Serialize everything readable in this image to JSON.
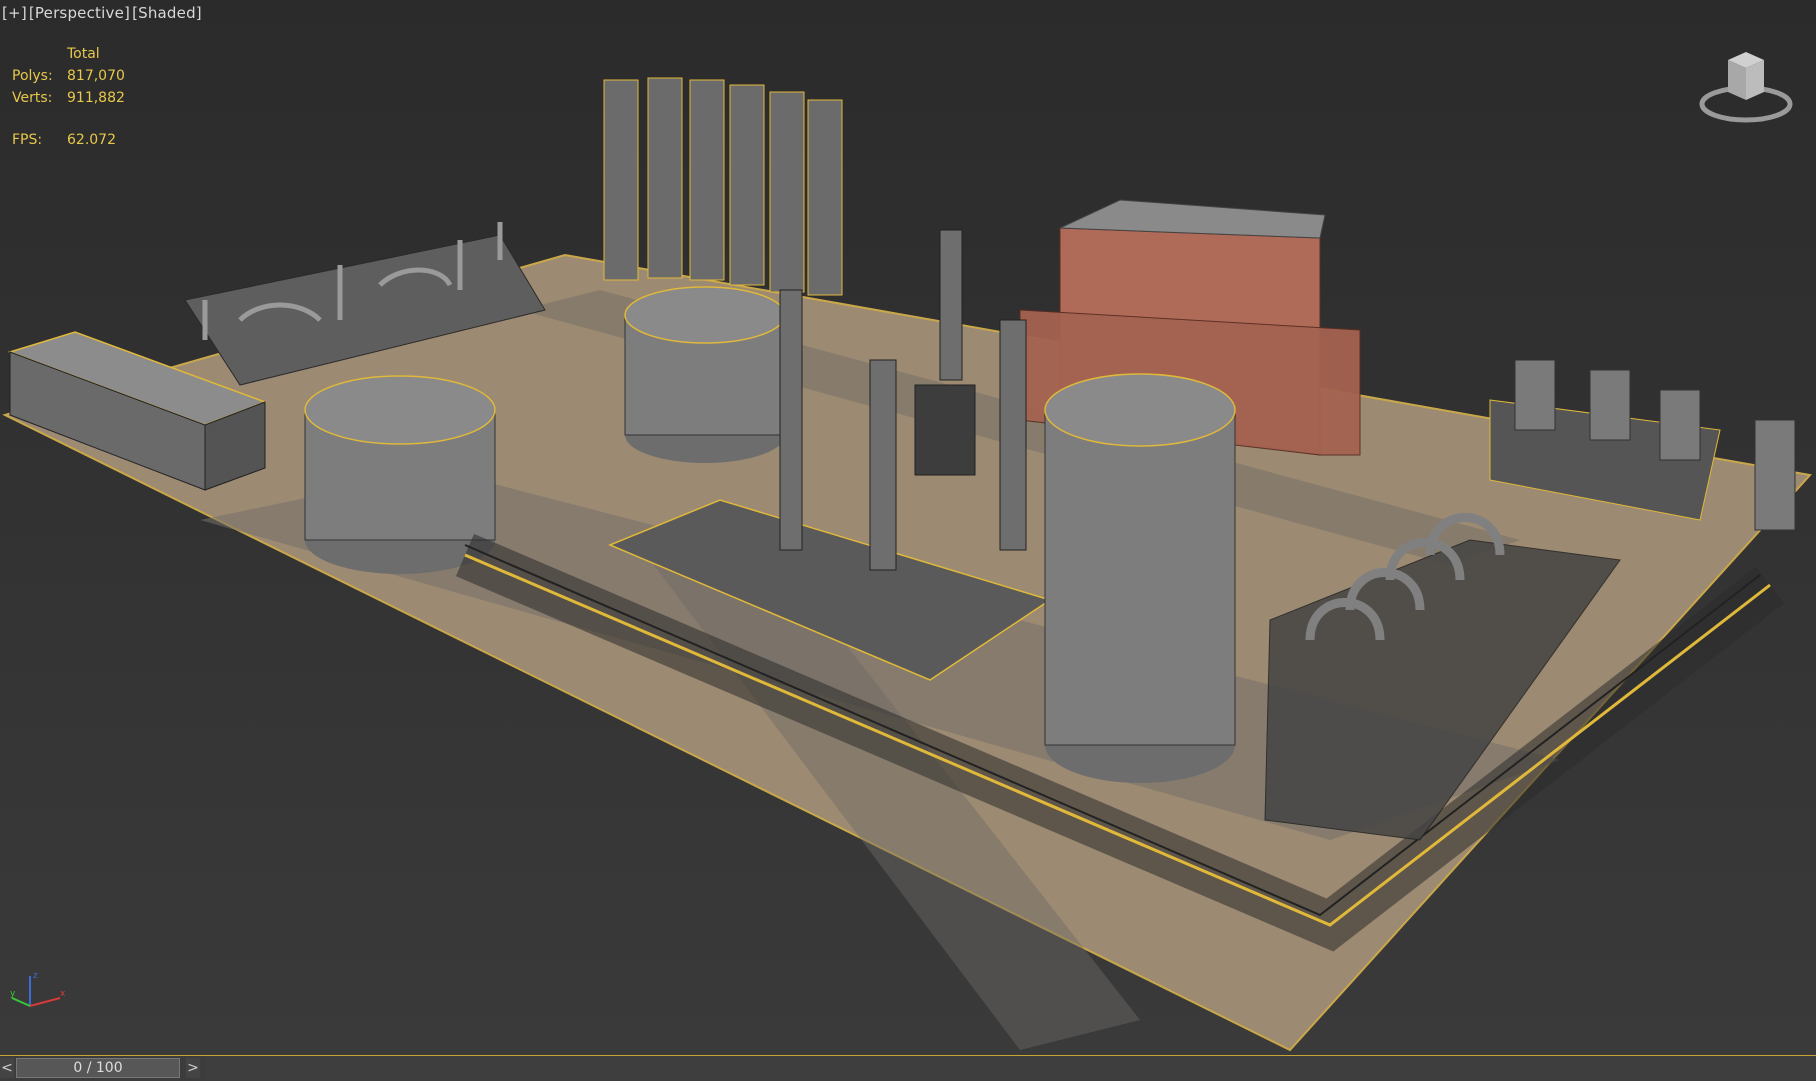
{
  "viewport": {
    "labels": [
      "[+]",
      "[Perspective]",
      "[Shaded]"
    ]
  },
  "stats": {
    "header": "Total",
    "polys_label": "Polys:",
    "polys_value": "817,070",
    "verts_label": "Verts:",
    "verts_value": "911,882",
    "fps_label": "FPS:",
    "fps_value": "62.072"
  },
  "timeline": {
    "prev_label": "<",
    "next_label": ">",
    "frame_text": "0 / 100",
    "current_frame": 0,
    "total_frames": 100
  },
  "axis": {
    "z": "z",
    "x": "x",
    "y": "y"
  },
  "colors": {
    "stats_text": "#e8c84a",
    "ground": "#9c8a72",
    "road": "#6e6a66",
    "tank": "#7d7d7d",
    "brick": "#b06a58",
    "selection": "#e0b83a",
    "steel": "#3a3a3a"
  },
  "icons": {
    "viewcube": "viewcube-icon",
    "axis": "axis-tripod-icon"
  }
}
